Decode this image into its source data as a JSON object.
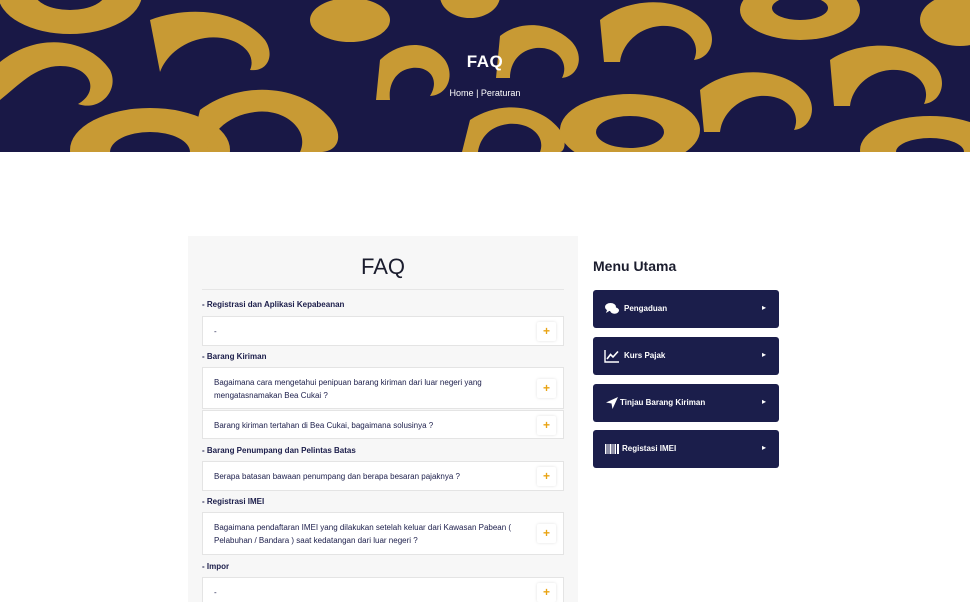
{
  "colors": {
    "hero_background": "#191846",
    "hero_ornament": "#c89a34",
    "menu_button": "#1b1e4b",
    "accent_plus": "#e9a414"
  },
  "hero": {
    "title": "FAQ",
    "breadcrumb_home": "Home",
    "breadcrumb_separator": " | ",
    "breadcrumb_current": "Peraturan"
  },
  "faq": {
    "title": "FAQ",
    "sections": [
      {
        "title": "- Registrasi dan Aplikasi Kepabeanan",
        "questions": [
          "-"
        ]
      },
      {
        "title": "- Barang Kiriman",
        "questions": [
          "Bagaimana cara mengetahui penipuan barang kiriman dari luar negeri yang mengatasnamakan Bea Cukai ?",
          "Barang kiriman tertahan di Bea Cukai, bagaimana solusinya ?"
        ]
      },
      {
        "title": "- Barang Penumpang dan Pelintas Batas",
        "questions": [
          "Berapa batasan bawaan penumpang dan berapa besaran pajaknya ?"
        ]
      },
      {
        "title": "- Registrasi IMEI",
        "questions": [
          "Bagaimana pendaftaran IMEI yang dilakukan setelah keluar dari Kawasan Pabean ( Pelabuhan / Bandara ) saat kedatangan dari luar negeri ?"
        ]
      },
      {
        "title": "- Impor",
        "questions": [
          "-"
        ]
      }
    ],
    "expand_symbol": "+"
  },
  "menu": {
    "title": "Menu Utama",
    "items": [
      {
        "label": "Pengaduan",
        "icon": "comments-icon"
      },
      {
        "label": "Kurs Pajak",
        "icon": "line-chart-icon"
      },
      {
        "label": "Tinjau Barang Kiriman",
        "icon": "location-arrow-icon"
      },
      {
        "label": "Registasi IMEI",
        "icon": "barcode-icon"
      }
    ],
    "arrow_symbol": "▸"
  }
}
